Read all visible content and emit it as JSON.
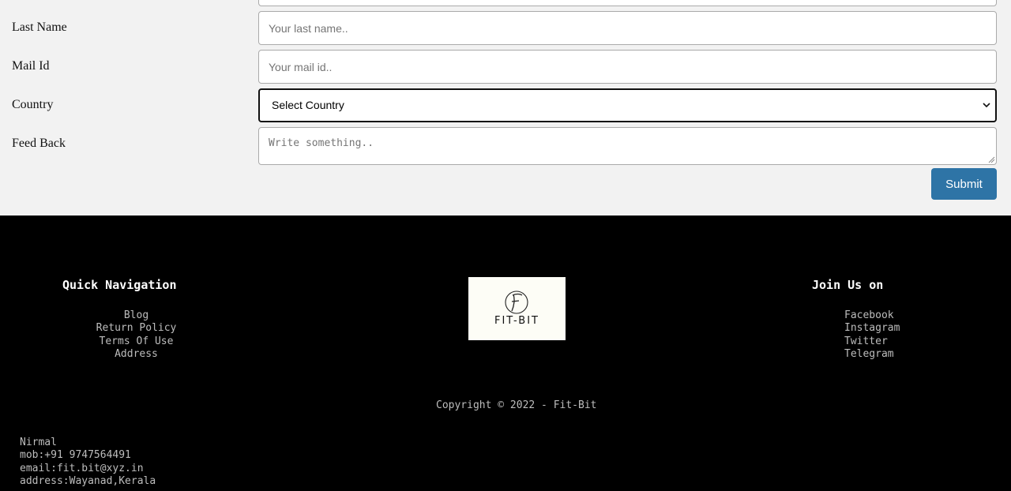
{
  "form": {
    "labels": {
      "last_name": "Last Name",
      "mail": "Mail Id",
      "country": "Country",
      "feedback": "Feed Back"
    },
    "placeholders": {
      "last_name": "Your last name..",
      "mail": "Your mail id..",
      "feedback": "Write something.."
    },
    "country_selected": "Select Country",
    "submit_label": "Submit",
    "submit_color": "#2e74a6"
  },
  "footer": {
    "quick_nav": {
      "heading": "Quick Navigation",
      "items": [
        "Blog",
        "Return Policy",
        "Terms Of Use",
        "Address"
      ]
    },
    "logo_text": "FIT-BIT",
    "join_us": {
      "heading": "Join Us on",
      "items": [
        "Facebook",
        "Instagram",
        "Twitter",
        "Telegram"
      ]
    },
    "copyright": "Copyright © 2022 - Fit-Bit",
    "contact": {
      "name": "Nirmal",
      "mobile": "mob:+91 9747564491",
      "email": "email:fit.bit@xyz.in",
      "address": "address:Wayanad,Kerala"
    }
  },
  "icons": {
    "select_arrow": "chevron-down-icon",
    "textarea_grip": "resize-grip-icon",
    "logo": "fitbit-logo"
  }
}
